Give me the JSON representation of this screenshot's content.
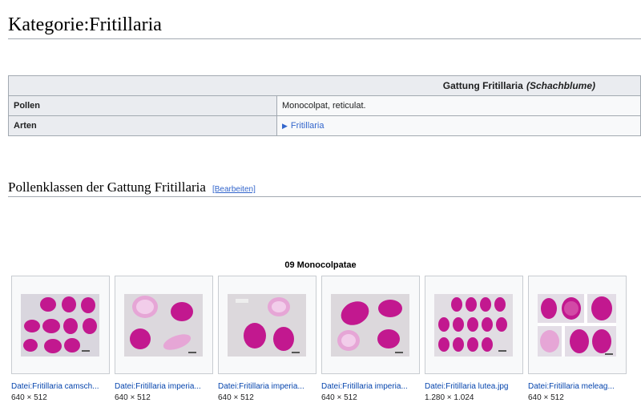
{
  "page_title": "Kategorie:Fritillaria",
  "infobox": {
    "genus_label": "Gattung Fritillaria",
    "common_name": "(Schachblume)",
    "rows": [
      {
        "label": "Pollen",
        "value": "Monocolpat, reticulat."
      },
      {
        "label": "Arten",
        "value": "Fritillaria"
      }
    ]
  },
  "section": {
    "heading": "Pollenklassen der Gattung Fritillaria",
    "edit_label": "[Bearbeiten]"
  },
  "gallery": {
    "caption": "09 Monocolpatae",
    "items": [
      {
        "name": "Datei:Fritillaria camsch...",
        "size": "640 × 512"
      },
      {
        "name": "Datei:Fritillaria imperia...",
        "size": "640 × 512"
      },
      {
        "name": "Datei:Fritillaria imperia...",
        "size": "640 × 512"
      },
      {
        "name": "Datei:Fritillaria imperia...",
        "size": "640 × 512"
      },
      {
        "name": "Datei:Fritillaria lutea.jpg",
        "size": "1.280 × 1.024"
      },
      {
        "name": "Datei:Fritillaria meleag...",
        "size": "640 × 512"
      }
    ]
  },
  "colors": {
    "link": "#0645ad",
    "pollen_magenta": "#c2188f",
    "pollen_light": "#e6a6d6",
    "border": "#a2a9b1"
  }
}
